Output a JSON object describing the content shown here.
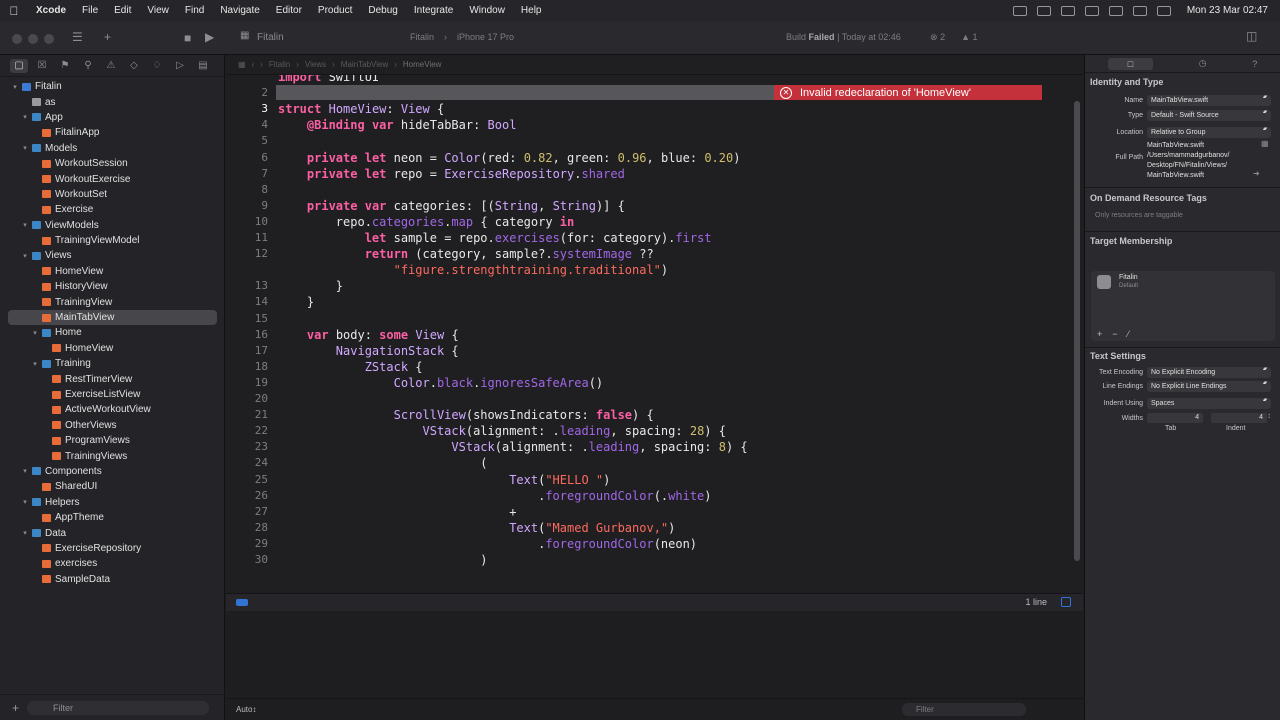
{
  "menubar": {
    "apple_icon": "apple-icon",
    "app_name": "Xcode",
    "menus": [
      "File",
      "Edit",
      "View",
      "Find",
      "Navigate",
      "Editor",
      "Product",
      "Debug",
      "Integrate",
      "Window",
      "Help"
    ],
    "clock": "Mon 23 Mar  02:47"
  },
  "toolbar": {
    "project_title": "Fitalin",
    "scheme": "Fitalin",
    "destination": "iPhone 17 Pro",
    "build_status_prefix": "Build",
    "build_status": "Failed",
    "build_time": "| Today at 02:46",
    "error_count": "2",
    "warning_count": "1"
  },
  "navigator": {
    "filter_placeholder": "Filter",
    "tree": [
      {
        "label": "Fitalin",
        "depth": 0,
        "type": "proj",
        "open": true
      },
      {
        "label": "as",
        "depth": 1,
        "type": "cat"
      },
      {
        "label": "App",
        "depth": 1,
        "type": "folder",
        "open": true
      },
      {
        "label": "FitalinApp",
        "depth": 2,
        "type": "swift"
      },
      {
        "label": "Models",
        "depth": 1,
        "type": "folder",
        "open": true
      },
      {
        "label": "WorkoutSession",
        "depth": 2,
        "type": "swift"
      },
      {
        "label": "WorkoutExercise",
        "depth": 2,
        "type": "swift"
      },
      {
        "label": "WorkoutSet",
        "depth": 2,
        "type": "swift"
      },
      {
        "label": "Exercise",
        "depth": 2,
        "type": "swift"
      },
      {
        "label": "ViewModels",
        "depth": 1,
        "type": "folder",
        "open": true
      },
      {
        "label": "TrainingViewModel",
        "depth": 2,
        "type": "swift"
      },
      {
        "label": "Views",
        "depth": 1,
        "type": "folder",
        "open": true
      },
      {
        "label": "HomeView",
        "depth": 2,
        "type": "swift"
      },
      {
        "label": "HistoryView",
        "depth": 2,
        "type": "swift"
      },
      {
        "label": "TrainingView",
        "depth": 2,
        "type": "swift"
      },
      {
        "label": "MainTabView",
        "depth": 2,
        "type": "swift",
        "selected": true
      },
      {
        "label": "Home",
        "depth": 2,
        "type": "folder",
        "open": true
      },
      {
        "label": "HomeView",
        "depth": 3,
        "type": "swift"
      },
      {
        "label": "Training",
        "depth": 2,
        "type": "folder",
        "open": true
      },
      {
        "label": "RestTimerView",
        "depth": 3,
        "type": "swift"
      },
      {
        "label": "ExerciseListView",
        "depth": 3,
        "type": "swift"
      },
      {
        "label": "ActiveWorkoutView",
        "depth": 3,
        "type": "swift"
      },
      {
        "label": "OtherViews",
        "depth": 3,
        "type": "swift"
      },
      {
        "label": "ProgramViews",
        "depth": 3,
        "type": "swift"
      },
      {
        "label": "TrainingViews",
        "depth": 3,
        "type": "swift"
      },
      {
        "label": "Components",
        "depth": 1,
        "type": "folder",
        "open": true
      },
      {
        "label": "SharedUI",
        "depth": 2,
        "type": "swift"
      },
      {
        "label": "Helpers",
        "depth": 1,
        "type": "folder",
        "open": true
      },
      {
        "label": "AppTheme",
        "depth": 2,
        "type": "swift"
      },
      {
        "label": "Data",
        "depth": 1,
        "type": "folder",
        "open": true
      },
      {
        "label": "ExerciseRepository",
        "depth": 2,
        "type": "swift"
      },
      {
        "label": "exercises",
        "depth": 2,
        "type": "swift"
      },
      {
        "label": "SampleData",
        "depth": 2,
        "type": "swift"
      }
    ]
  },
  "editor": {
    "jumpbar": [
      "Fitalin",
      "Views",
      "MainTabView",
      "HomeView"
    ],
    "error_message": "Invalid redeclaration of 'HomeView'",
    "error_line": "3",
    "lines": [
      {
        "n": "",
        "html": "<span class='kw'>import</span> SwiftUI"
      },
      {
        "n": "2",
        "html": ""
      },
      {
        "n": "3",
        "html": "<span class='kw'>struct</span> <span class='ty'>HomeView</span>: <span class='ty'>View</span> {"
      },
      {
        "n": "4",
        "html": "    <span class='kw'>@Binding</span> <span class='kw'>var</span> hideTabBar: <span class='ty'>Bool</span>"
      },
      {
        "n": "5",
        "html": ""
      },
      {
        "n": "6",
        "html": "    <span class='kw'>private</span> <span class='kw'>let</span> neon = <span class='ty'>Color</span>(red: <span class='nu'>0.82</span>, green: <span class='nu'>0.96</span>, blue: <span class='nu'>0.20</span>)"
      },
      {
        "n": "7",
        "html": "    <span class='kw'>private</span> <span class='kw'>let</span> repo = <span class='ty'>ExerciseRepository</span>.<span class='fn'>shared</span>"
      },
      {
        "n": "8",
        "html": ""
      },
      {
        "n": "9",
        "html": "    <span class='kw'>private</span> <span class='kw'>var</span> categories: [(<span class='ty'>String</span>, <span class='ty'>String</span>)] {"
      },
      {
        "n": "10",
        "html": "        repo.<span class='fn'>categories</span>.<span class='fn'>map</span> { category <span class='kw'>in</span>"
      },
      {
        "n": "11",
        "html": "            <span class='kw'>let</span> sample = repo.<span class='fn'>exercises</span>(for: category).<span class='fn'>first</span>"
      },
      {
        "n": "12",
        "html": "            <span class='kw'>return</span> (category, sample?.<span class='fn'>systemImage</span> ??"
      },
      {
        "n": "",
        "html": "                <span class='st'>\"figure.strengthtraining.traditional\"</span>)"
      },
      {
        "n": "13",
        "html": "        }"
      },
      {
        "n": "14",
        "html": "    }"
      },
      {
        "n": "15",
        "html": ""
      },
      {
        "n": "16",
        "html": "    <span class='kw'>var</span> body: <span class='kw'>some</span> <span class='ty'>View</span> {"
      },
      {
        "n": "17",
        "html": "        <span class='ty'>NavigationStack</span> {"
      },
      {
        "n": "18",
        "html": "            <span class='ty'>ZStack</span> {"
      },
      {
        "n": "19",
        "html": "                <span class='ty'>Color</span>.<span class='fn'>black</span>.<span class='fn'>ignoresSafeArea</span>()"
      },
      {
        "n": "20",
        "html": ""
      },
      {
        "n": "21",
        "html": "                <span class='ty'>ScrollView</span>(showsIndicators: <span class='kw'>false</span>) {"
      },
      {
        "n": "22",
        "html": "                    <span class='ty'>VStack</span>(alignment: .<span class='fn'>leading</span>, spacing: <span class='nu'>28</span>) {"
      },
      {
        "n": "23",
        "html": "                        <span class='ty'>VStack</span>(alignment: .<span class='fn'>leading</span>, spacing: <span class='nu'>8</span>) {"
      },
      {
        "n": "24",
        "html": "                            ("
      },
      {
        "n": "25",
        "html": "                                <span class='ty'>Text</span>(<span class='st'>\"HELLO \"</span>)"
      },
      {
        "n": "26",
        "html": "                                    .<span class='fn'>foregroundColor</span>(.<span class='fn'>white</span>)"
      },
      {
        "n": "27",
        "html": "                                +"
      },
      {
        "n": "28",
        "html": "                                <span class='ty'>Text</span>(<span class='st'>\"Mamed Gurbanov,\"</span>)"
      },
      {
        "n": "29",
        "html": "                                    .<span class='fn'>foregroundColor</span>(neon)"
      },
      {
        "n": "30",
        "html": "                            )"
      }
    ],
    "line_count_label": "1 line",
    "bottom_mode": "Auto",
    "console_filter_placeholder": "Filter"
  },
  "inspector": {
    "section_identity": "Identity and Type",
    "name_label": "Name",
    "name_value": "MainTabView.swift",
    "type_label": "Type",
    "type_value": "Default - Swift Source",
    "location_label": "Location",
    "location_value": "Relative to Group",
    "location_file": "MainTabView.swift",
    "fullpath_label": "Full Path",
    "fullpath_value_1": "/Users/mammadgurbanov/",
    "fullpath_value_2": "Desktop/FN/Fitalin/Views/",
    "fullpath_value_3": "MainTabView.swift",
    "section_tags": "On Demand Resource Tags",
    "tags_hint": "Only resources are taggable",
    "section_target": "Target Membership",
    "target_name": "Fitalin",
    "target_sub": "Default",
    "section_text": "Text Settings",
    "encoding_label": "Text Encoding",
    "encoding_value": "No Explicit Encoding",
    "endings_label": "Line Endings",
    "endings_value": "No Explicit Line Endings",
    "indent_label": "Indent Using",
    "indent_value": "Spaces",
    "widths_label": "Widths",
    "tab_value": "4",
    "indent_width_value": "4",
    "tab_label": "Tab",
    "indent_sub_label": "Indent"
  },
  "colors": {
    "error_red": "#c4313b",
    "accent_blue": "#3273d6",
    "keyword_pink": "#fc5fa3"
  }
}
